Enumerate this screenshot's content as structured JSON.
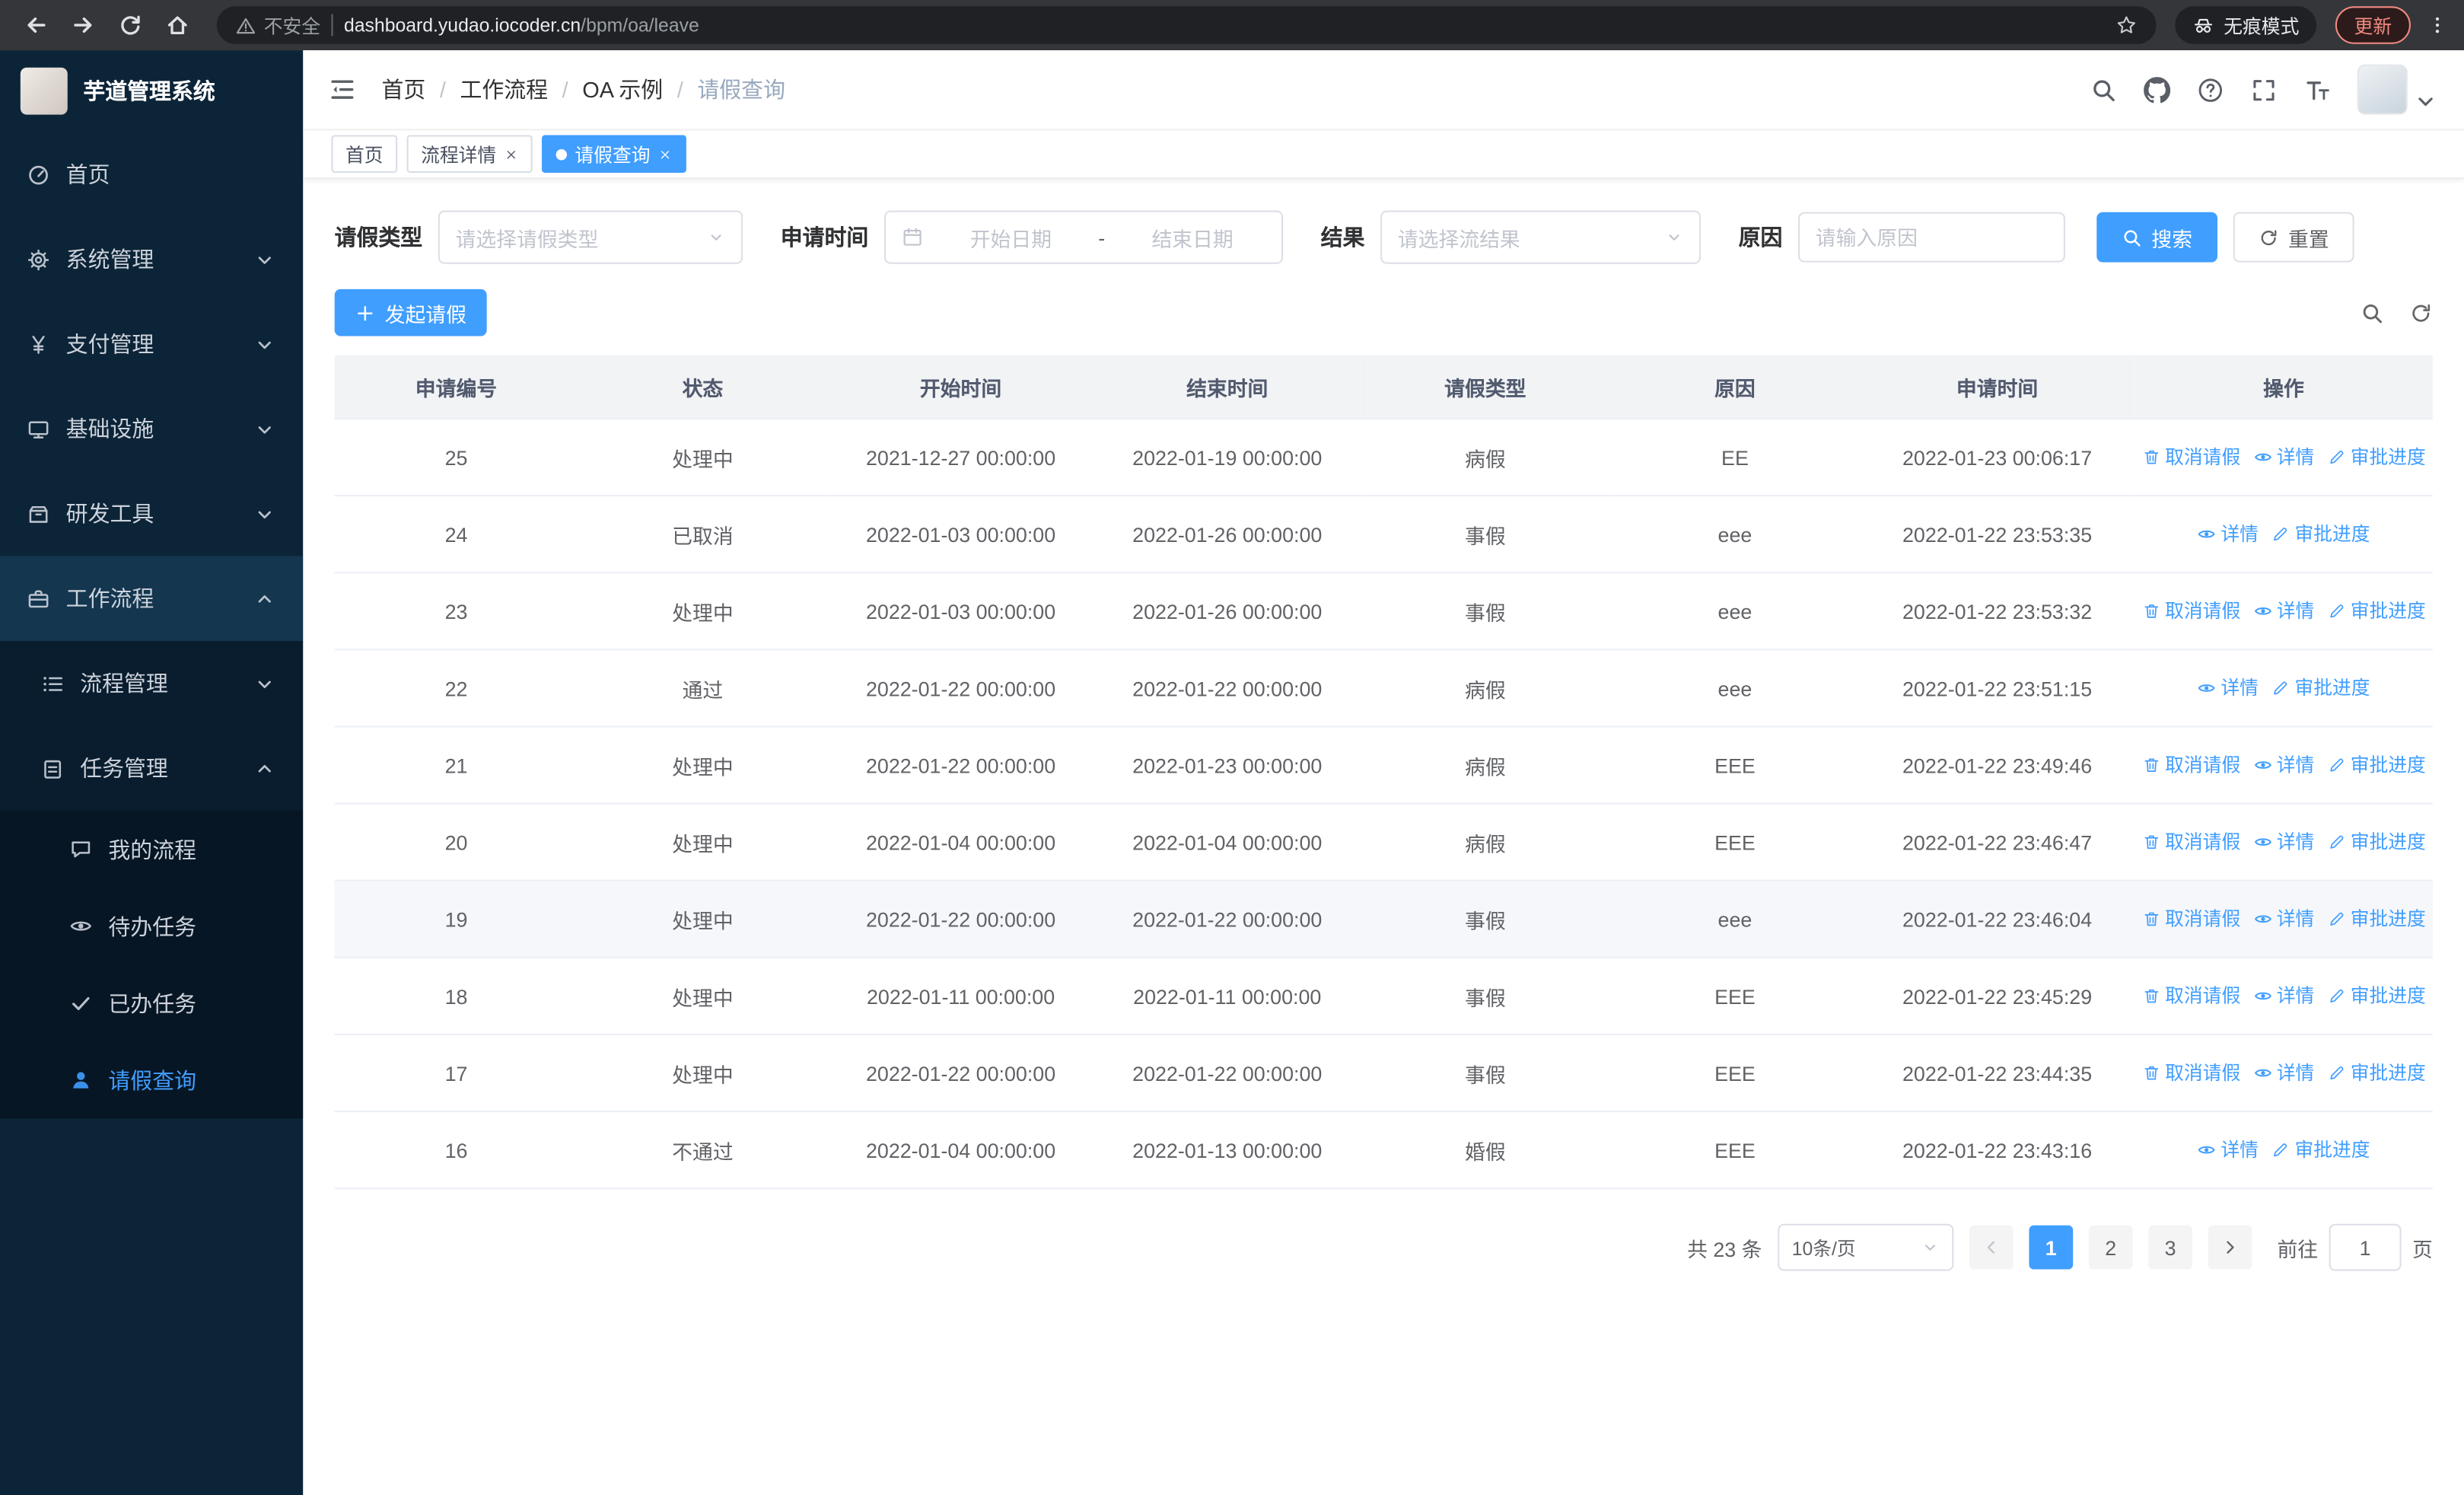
{
  "colors": {
    "accent": "#409eff",
    "sidebar_bg": "#0c2437"
  },
  "browser": {
    "security_warning": "不安全",
    "url_domain": "dashboard.yudao.iocoder.cn",
    "url_path": "/bpm/oa/leave",
    "incognito_label": "无痕模式",
    "update_label": "更新"
  },
  "sidebar": {
    "logo_title": "芋道管理系统",
    "items": [
      {
        "icon": "gauge",
        "label": "首页",
        "level": 1
      },
      {
        "icon": "gear",
        "label": "系统管理",
        "level": 1,
        "chevron": "down"
      },
      {
        "icon": "yen",
        "label": "支付管理",
        "level": 1,
        "chevron": "down"
      },
      {
        "icon": "monitor",
        "label": "基础设施",
        "level": 1,
        "chevron": "down"
      },
      {
        "icon": "box",
        "label": "研发工具",
        "level": 1,
        "chevron": "down"
      },
      {
        "icon": "briefcase",
        "label": "工作流程",
        "level": 1,
        "chevron": "up",
        "open": true
      },
      {
        "icon": "list",
        "label": "流程管理",
        "level": 2,
        "chevron": "down"
      },
      {
        "icon": "clipboard",
        "label": "任务管理",
        "level": 2,
        "chevron": "up"
      },
      {
        "icon": "chat",
        "label": "我的流程",
        "level": 3
      },
      {
        "icon": "eye",
        "label": "待办任务",
        "level": 3
      },
      {
        "icon": "check",
        "label": "已办任务",
        "level": 3
      },
      {
        "icon": "user",
        "label": "请假查询",
        "level": 3,
        "active": true
      }
    ]
  },
  "header": {
    "breadcrumb": [
      "首页",
      "工作流程",
      "OA 示例",
      "请假查询"
    ]
  },
  "tags": [
    {
      "label": "首页",
      "closable": false,
      "active": false
    },
    {
      "label": "流程详情",
      "closable": true,
      "active": false
    },
    {
      "label": "请假查询",
      "closable": true,
      "active": true
    }
  ],
  "filters": {
    "leave_type_label": "请假类型",
    "leave_type_placeholder": "请选择请假类型",
    "apply_time_label": "申请时间",
    "start_date_placeholder": "开始日期",
    "range_separator": "-",
    "end_date_placeholder": "结束日期",
    "result_label": "结果",
    "result_placeholder": "请选择流结果",
    "reason_label": "原因",
    "reason_placeholder": "请输入原因",
    "search_label": "搜索",
    "reset_label": "重置"
  },
  "toolbar": {
    "create_label": "发起请假"
  },
  "table": {
    "columns": [
      "申请编号",
      "状态",
      "开始时间",
      "结束时间",
      "请假类型",
      "原因",
      "申请时间",
      "操作"
    ],
    "action_labels": {
      "cancel": "取消请假",
      "detail": "详情",
      "progress": "审批进度"
    },
    "rows": [
      {
        "id": "25",
        "status": "处理中",
        "start": "2021-12-27 00:00:00",
        "end": "2022-01-19 00:00:00",
        "type": "病假",
        "reason": "EE",
        "applied": "2022-01-23 00:06:17",
        "cancellable": true
      },
      {
        "id": "24",
        "status": "已取消",
        "start": "2022-01-03 00:00:00",
        "end": "2022-01-26 00:00:00",
        "type": "事假",
        "reason": "eee",
        "applied": "2022-01-22 23:53:35",
        "cancellable": false
      },
      {
        "id": "23",
        "status": "处理中",
        "start": "2022-01-03 00:00:00",
        "end": "2022-01-26 00:00:00",
        "type": "事假",
        "reason": "eee",
        "applied": "2022-01-22 23:53:32",
        "cancellable": true
      },
      {
        "id": "22",
        "status": "通过",
        "start": "2022-01-22 00:00:00",
        "end": "2022-01-22 00:00:00",
        "type": "病假",
        "reason": "eee",
        "applied": "2022-01-22 23:51:15",
        "cancellable": false
      },
      {
        "id": "21",
        "status": "处理中",
        "start": "2022-01-22 00:00:00",
        "end": "2022-01-23 00:00:00",
        "type": "病假",
        "reason": "EEE",
        "applied": "2022-01-22 23:49:46",
        "cancellable": true
      },
      {
        "id": "20",
        "status": "处理中",
        "start": "2022-01-04 00:00:00",
        "end": "2022-01-04 00:00:00",
        "type": "病假",
        "reason": "EEE",
        "applied": "2022-01-22 23:46:47",
        "cancellable": true
      },
      {
        "id": "19",
        "status": "处理中",
        "start": "2022-01-22 00:00:00",
        "end": "2022-01-22 00:00:00",
        "type": "事假",
        "reason": "eee",
        "applied": "2022-01-22 23:46:04",
        "cancellable": true,
        "hover": true
      },
      {
        "id": "18",
        "status": "处理中",
        "start": "2022-01-11 00:00:00",
        "end": "2022-01-11 00:00:00",
        "type": "事假",
        "reason": "EEE",
        "applied": "2022-01-22 23:45:29",
        "cancellable": true
      },
      {
        "id": "17",
        "status": "处理中",
        "start": "2022-01-22 00:00:00",
        "end": "2022-01-22 00:00:00",
        "type": "事假",
        "reason": "EEE",
        "applied": "2022-01-22 23:44:35",
        "cancellable": true
      },
      {
        "id": "16",
        "status": "不通过",
        "start": "2022-01-04 00:00:00",
        "end": "2022-01-13 00:00:00",
        "type": "婚假",
        "reason": "EEE",
        "applied": "2022-01-22 23:43:16",
        "cancellable": false
      }
    ]
  },
  "pagination": {
    "total_text": "共 23 条",
    "page_size": "10条/页",
    "pages": [
      "1",
      "2",
      "3"
    ],
    "active_page": "1",
    "goto_label": "前往",
    "goto_value": "1",
    "goto_suffix": "页"
  }
}
